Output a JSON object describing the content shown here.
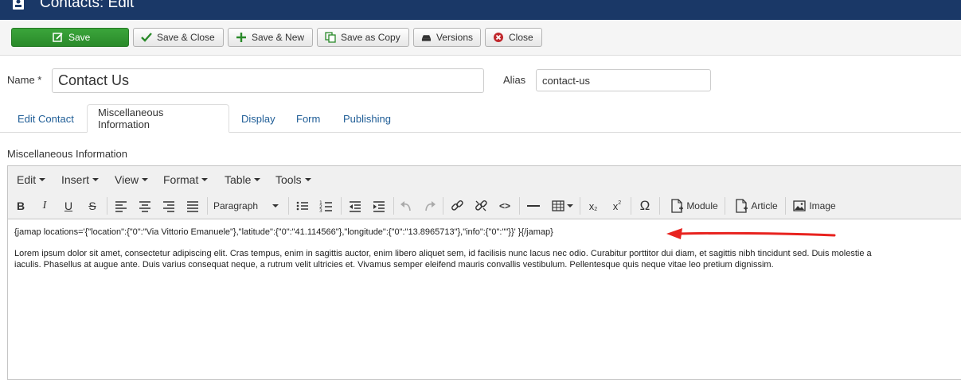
{
  "header": {
    "title": "Contacts: Edit"
  },
  "toolbar": {
    "save": "Save",
    "save_close": "Save & Close",
    "save_new": "Save & New",
    "save_copy": "Save as Copy",
    "versions": "Versions",
    "close": "Close"
  },
  "form": {
    "name_label": "Name *",
    "name_value": "Contact Us",
    "alias_label": "Alias",
    "alias_value": "contact-us"
  },
  "tabs": [
    {
      "label": "Edit Contact"
    },
    {
      "label": "Miscellaneous Information"
    },
    {
      "label": "Display"
    },
    {
      "label": "Form"
    },
    {
      "label": "Publishing"
    }
  ],
  "section_title": "Miscellaneous Information",
  "editor": {
    "menus": [
      "Edit",
      "Insert",
      "View",
      "Format",
      "Table",
      "Tools"
    ],
    "format_select": "Paragraph",
    "module_label": "Module",
    "article_label": "Article",
    "image_label": "Image",
    "content_line1": "{jamap locations='{\"location\":{\"0\":\"Via Vittorio Emanuele\"},\"latitude\":{\"0\":\"41.114566\"},\"longitude\":{\"0\":\"13.8965713\"},\"info\":{\"0\":\"\"}}' }{/jamap}",
    "content_para_line1": "Lorem ipsum dolor sit amet, consectetur adipiscing elit. Cras tempus, enim in sagittis auctor, enim libero aliquet sem, id facilisis nunc lacus nec odio. Curabitur porttitor dui diam, et sagittis nibh tincidunt sed. Duis molestie a",
    "content_para_line2": "iaculis. Phasellus at augue ante. Duis varius consequat neque, a rutrum velit ultricies et. Vivamus semper eleifend mauris convallis vestibulum. Pellentesque quis neque vitae leo pretium dignissim."
  },
  "colors": {
    "header_bg": "#1a3867",
    "save_green": "#2f962f",
    "link_blue": "#1f5d96",
    "annotation_red": "#e8231f"
  }
}
